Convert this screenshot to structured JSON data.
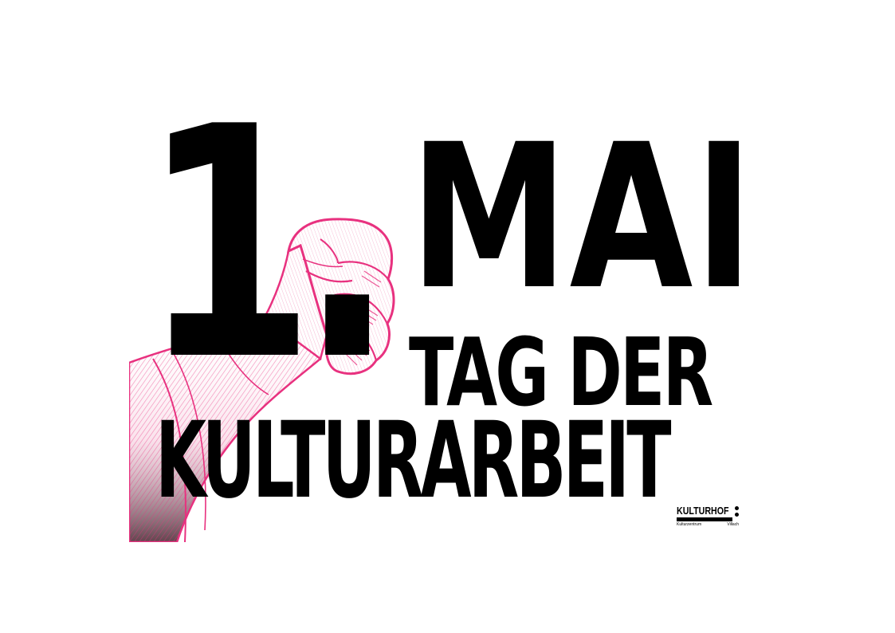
{
  "poster": {
    "number": "1.",
    "title": "MAI",
    "subtitle_line1": "TAG DER",
    "subtitle_line2": "KULTURARBEIT"
  },
  "logo": {
    "name": "KULTURHOF",
    "sub_left": "Kulturzentrum",
    "sub_right": "Villach"
  },
  "colors": {
    "text": "#000000",
    "illustration": "#e8317f",
    "background": "#ffffff"
  },
  "icons": {
    "illustration": "raised-fist-icon"
  }
}
